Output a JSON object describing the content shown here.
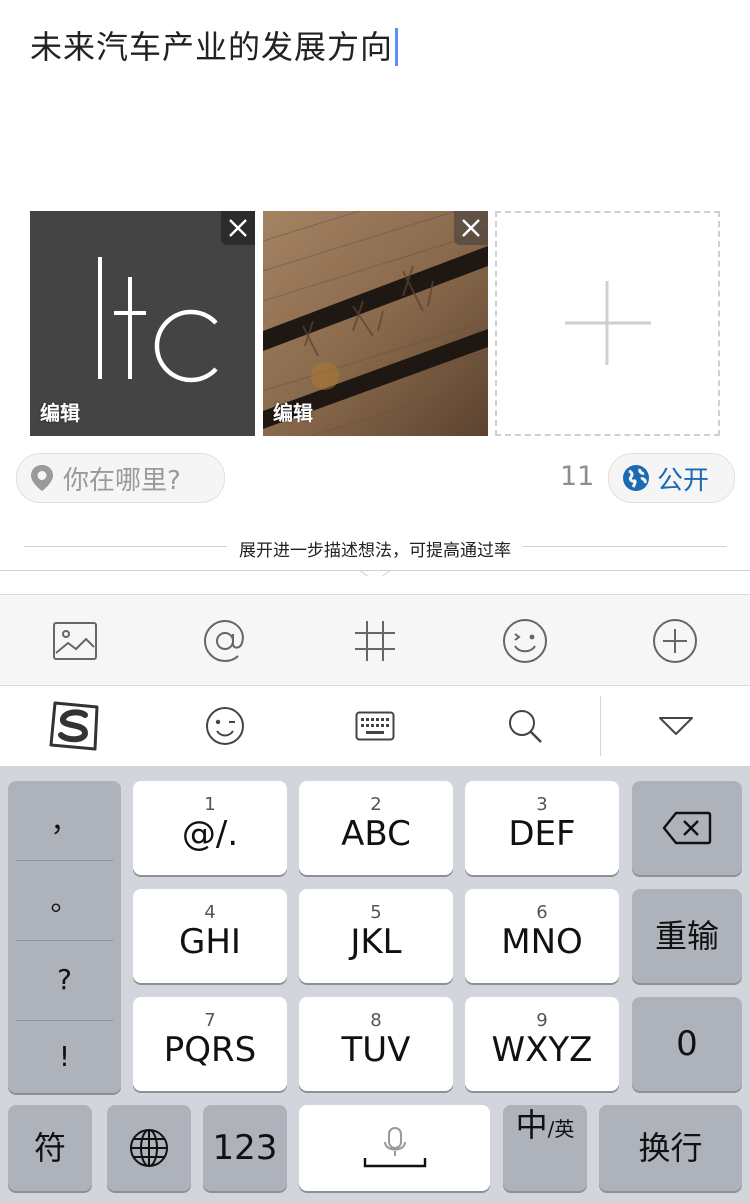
{
  "composer": {
    "text": "未来汽车产业的发展方向"
  },
  "photos": [
    {
      "edit_label": "编辑",
      "thumb_text": "ltc"
    },
    {
      "edit_label": "编辑"
    }
  ],
  "location": {
    "placeholder": "你在哪里?"
  },
  "word_count": "11",
  "visibility": {
    "label": "公开"
  },
  "hint": "展开进一步描述想法，可提高通过率",
  "colors": {
    "accent_blue": "#1b6ab4",
    "caret": "#5b8ff9",
    "keyboard_bg": "#d3d5dc"
  },
  "toolbar": {
    "items": [
      "image-icon",
      "at-icon",
      "hashtag-icon",
      "emoji-icon",
      "plus-circle-icon"
    ]
  },
  "ime_bar": {
    "items": [
      "sogou-logo-icon",
      "wink-emoji-icon",
      "keyboard-icon",
      "search-icon",
      "collapse-keyboard-icon"
    ]
  },
  "keyboard": {
    "punctuation": [
      "，",
      "。",
      "?",
      "!"
    ],
    "keys": [
      {
        "num": "1",
        "label": "@/."
      },
      {
        "num": "2",
        "label": "ABC"
      },
      {
        "num": "3",
        "label": "DEF"
      },
      {
        "num": "4",
        "label": "GHI"
      },
      {
        "num": "5",
        "label": "JKL"
      },
      {
        "num": "6",
        "label": "MNO"
      },
      {
        "num": "7",
        "label": "PQRS"
      },
      {
        "num": "8",
        "label": "TUV"
      },
      {
        "num": "9",
        "label": "WXYZ"
      }
    ],
    "reenter": "重输",
    "zero": "0",
    "symbols": "符",
    "numbers": "123",
    "lang_main": "中",
    "lang_sub": "/英",
    "return": "换行"
  }
}
